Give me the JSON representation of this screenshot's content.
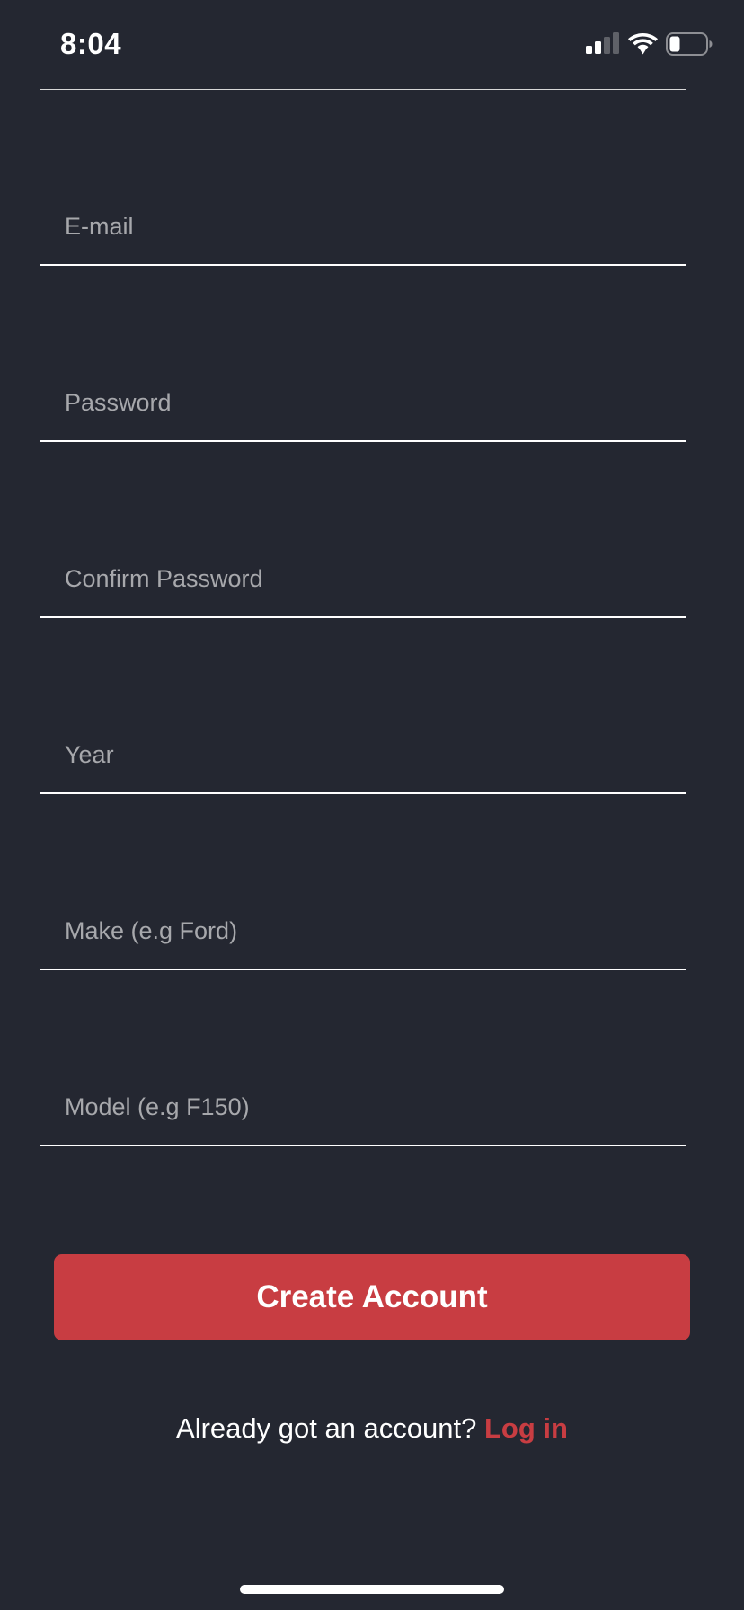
{
  "status_bar": {
    "time": "8:04",
    "icons": [
      "signal-icon",
      "wifi-icon",
      "battery-icon"
    ]
  },
  "form": {
    "fields": [
      {
        "name": "email",
        "value": "",
        "placeholder": "E-mail"
      },
      {
        "name": "password",
        "value": "",
        "placeholder": "Password"
      },
      {
        "name": "confirm_password",
        "value": "",
        "placeholder": "Confirm Password"
      },
      {
        "name": "year",
        "value": "",
        "placeholder": "Year"
      },
      {
        "name": "make",
        "value": "",
        "placeholder": "Make (e.g Ford)"
      },
      {
        "name": "model",
        "value": "",
        "placeholder": "Model (e.g F150)"
      }
    ],
    "submit_label": "Create Account"
  },
  "footer": {
    "prompt": "Already got an account?",
    "link_label": "Log in"
  },
  "colors": {
    "background": "#242731",
    "accent": "#c83d42",
    "placeholder": "#a7a8ac",
    "text": "#ffffff"
  }
}
